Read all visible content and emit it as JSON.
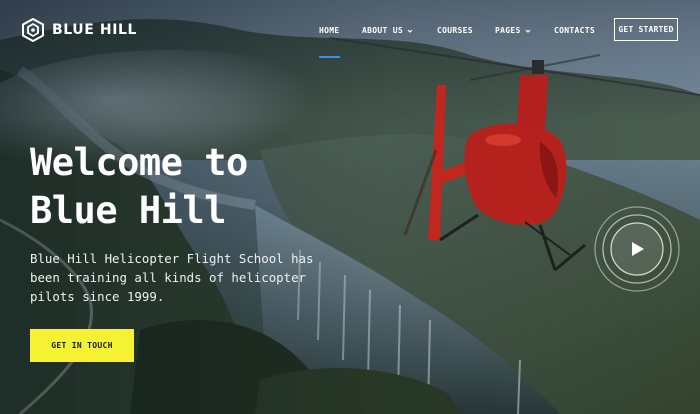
{
  "brand": {
    "name": "BLUE HILL",
    "icon": "hexagon-logo-icon"
  },
  "nav": {
    "items": [
      {
        "label": "HOME",
        "active": true
      },
      {
        "label": "ABOUT US",
        "dropdown": true
      },
      {
        "label": "COURSES"
      },
      {
        "label": "PAGES",
        "dropdown": true
      },
      {
        "label": "CONTACTS"
      }
    ],
    "cta": "GET STARTED",
    "active_color": "#3b8df0"
  },
  "hero": {
    "title_line1": "Welcome to",
    "title_line2": "Blue Hill",
    "subtitle_line1": "Blue Hill Helicopter Flight School has",
    "subtitle_line2": "been training all kinds of helicopter",
    "subtitle_line3": "pilots since 1999.",
    "button": "GET IN TOUCH",
    "button_color": "#f4f233",
    "video_icon": "play-icon"
  }
}
